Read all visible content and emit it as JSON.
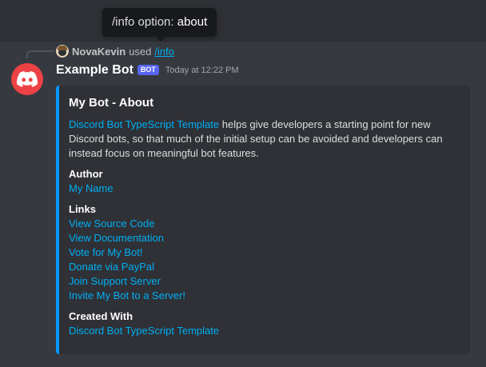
{
  "tooltip": {
    "prefix": "/info option:",
    "value": "about"
  },
  "reply": {
    "username": "NovaKevin",
    "used": "used",
    "command": "/info"
  },
  "message": {
    "author": "Example Bot",
    "bot_tag": "BOT",
    "timestamp": "Today at 12:22 PM"
  },
  "embed": {
    "color": "#0099ff",
    "title": "My Bot - About",
    "description": {
      "link": "Discord Bot TypeScript Template",
      "text": "helps give developers a starting point for new Discord bots, so that much of the initial setup can be avoided and developers can instead focus on meaningful bot features."
    },
    "fields": {
      "author": {
        "name": "Author",
        "value": "My Name"
      },
      "links": {
        "name": "Links",
        "values": [
          "View Source Code",
          "View Documentation",
          "Vote for My Bot!",
          "Donate via PayPal",
          "Join Support Server",
          "Invite My Bot to a Server!"
        ]
      },
      "created_with": {
        "name": "Created With",
        "value": "Discord Bot TypeScript Template"
      }
    }
  },
  "icons": {
    "avatar": "discord-logo-icon",
    "user_avatar": "user-avatar-icon"
  },
  "colors": {
    "background": "#36393f",
    "embed_background": "#2f3136",
    "link": "#00aff4",
    "bot_tag": "#5865f2",
    "avatar": "#ed4245"
  }
}
